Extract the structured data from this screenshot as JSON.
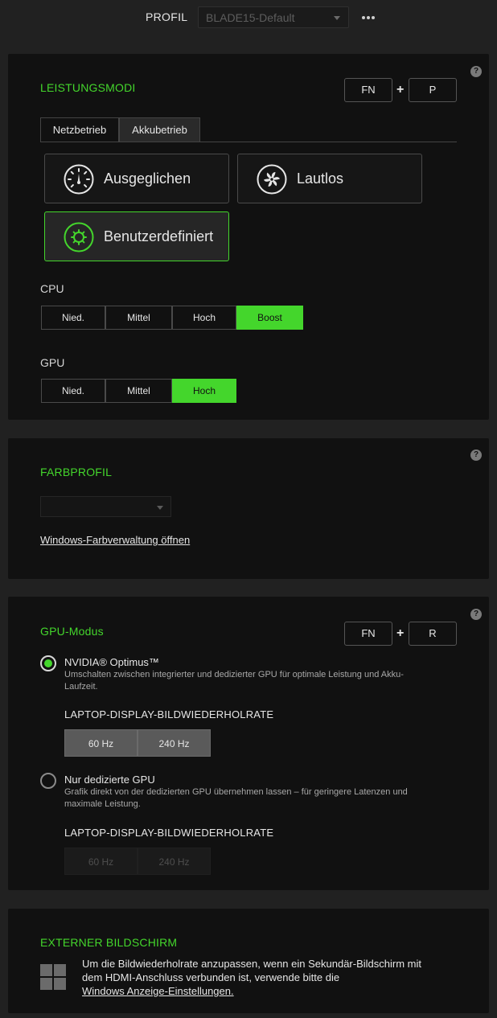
{
  "header": {
    "profile_label": "PROFIL",
    "profile_value": "BLADE15-Default"
  },
  "performance": {
    "title": "LEISTUNGSMODI",
    "shortcut": {
      "key1": "FN",
      "plus": "+",
      "key2": "P"
    },
    "tabs": [
      {
        "label": "Netzbetrieb",
        "active": true
      },
      {
        "label": "Akkubetrieb",
        "active": false
      }
    ],
    "modes": [
      {
        "label": "Ausgeglichen",
        "selected": false
      },
      {
        "label": "Lautlos",
        "selected": false
      },
      {
        "label": "Benutzerdefiniert",
        "selected": true
      }
    ],
    "cpu_label": "CPU",
    "cpu_options": [
      "Nied.",
      "Mittel",
      "Hoch",
      "Boost"
    ],
    "cpu_selected": "Boost",
    "gpu_label": "GPU",
    "gpu_options": [
      "Nied.",
      "Mittel",
      "Hoch"
    ],
    "gpu_selected": "Hoch"
  },
  "color_profile": {
    "title": "FARBPROFIL",
    "dropdown_value": "",
    "link": "Windows-Farbverwaltung öffnen"
  },
  "gpu_mode": {
    "title": "GPU-Modus",
    "shortcut": {
      "key1": "FN",
      "plus": "+",
      "key2": "R"
    },
    "options": [
      {
        "title": "NVIDIA® Optimus™",
        "desc_line1": "Umschalten zwischen integrierter und dedizierter GPU für optimale Leistung und Akku-",
        "desc_line2": "Laufzeit.",
        "selected": true,
        "rate_label": "LAPTOP-DISPLAY-BILDWIEDERHOLRATE",
        "rates": [
          "60 Hz",
          "240 Hz"
        ]
      },
      {
        "title": "Nur dedizierte GPU",
        "desc_line1": "Grafik direkt von der dedizierten GPU übernehmen lassen – für geringere Latenzen und",
        "desc_line2": "maximale Leistung.",
        "selected": false,
        "rate_label": "LAPTOP-DISPLAY-BILDWIEDERHOLRATE",
        "rates": [
          "60 Hz",
          "240 Hz"
        ]
      }
    ]
  },
  "external_display": {
    "title": "EXTERNER BILDSCHIRM",
    "text_line1": "Um die Bildwiederholrate anzupassen, wenn ein Sekundär-Bildschirm mit",
    "text_line2": "dem HDMI-Anschluss verbunden ist, verwende bitte die",
    "link": "Windows Anzeige-Einstellungen."
  },
  "colors": {
    "accent": "#44d62c",
    "panel": "#111111",
    "background": "#212121"
  },
  "icons": [
    "more-icon",
    "help-icon",
    "speedometer-icon",
    "fan-icon",
    "gear-icon",
    "windows-icon",
    "caret-down-icon"
  ]
}
